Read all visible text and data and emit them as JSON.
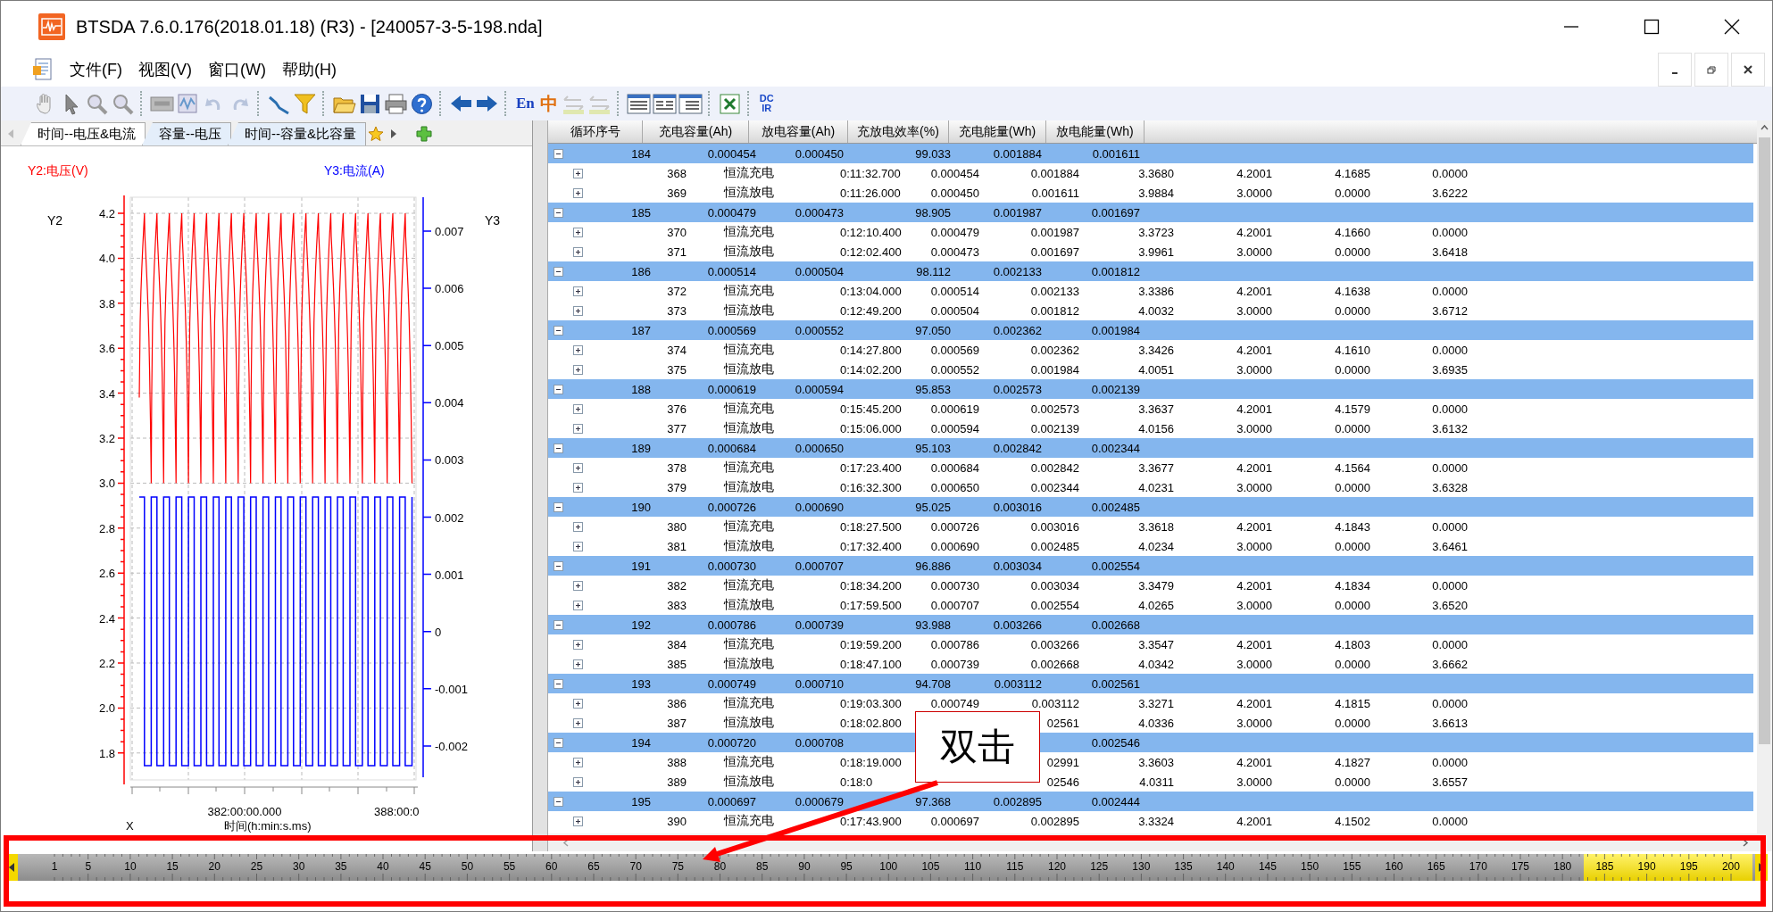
{
  "window": {
    "title": "BTSDA 7.6.0.176(2018.01.18) (R3) - [240057-3-5-198.nda]"
  },
  "menu": [
    {
      "label": "文件(F)"
    },
    {
      "label": "视图(V)"
    },
    {
      "label": "窗口(W)"
    },
    {
      "label": "帮助(H)"
    }
  ],
  "toolbar": {
    "language_label": "En",
    "chinese_label": "中",
    "dcir_top": "DC",
    "dcir_bottom": "IR"
  },
  "tabs": [
    {
      "label": "时间--电压&电流",
      "selected": true
    },
    {
      "label": "容量--电压",
      "selected": false
    },
    {
      "label": "时间--容量&比容量",
      "selected": false
    }
  ],
  "chart": {
    "y2_legend": "Y2:电压(V)",
    "y3_legend": "Y3:电流(A)",
    "y2_name": "Y2",
    "y3_name": "Y3",
    "y2_ticks": [
      "4.2",
      "4.0",
      "3.8",
      "3.6",
      "3.4",
      "3.2",
      "3.0",
      "2.8",
      "2.6",
      "2.4",
      "2.2",
      "2.0",
      "1.8"
    ],
    "y3_ticks": [
      "0.007",
      "0.006",
      "0.005",
      "0.004",
      "0.003",
      "0.002",
      "0.001",
      "0",
      "-0.001",
      "-0.002"
    ],
    "x_ticks": [
      "382:00:00.000",
      "388:00:0"
    ],
    "x_name": "X",
    "x_title": "时间(h:min:s.ms)"
  },
  "table": {
    "columns": [
      "循环序号",
      "充电容量(Ah)",
      "放电容量(Ah)",
      "充放电效率(%)",
      "充电能量(Wh)",
      "放电能量(Wh)"
    ],
    "groups": [
      {
        "expanded": true,
        "cells": [
          "184",
          "0.000454",
          "0.000450",
          "99.033",
          "0.001884",
          "0.001611"
        ],
        "children": [
          {
            "expanded": false,
            "cells": [
              "368",
              "恒流充电",
              "0:11:32.700",
              "0.000454",
              "0.001884",
              "3.3680",
              "4.2001",
              "4.1685",
              "0.0000"
            ]
          },
          {
            "expanded": false,
            "cells": [
              "369",
              "恒流放电",
              "0:11:26.000",
              "0.000450",
              "0.001611",
              "3.9884",
              "3.0000",
              "0.0000",
              "3.6222"
            ]
          }
        ]
      },
      {
        "expanded": true,
        "cells": [
          "185",
          "0.000479",
          "0.000473",
          "98.905",
          "0.001987",
          "0.001697"
        ],
        "children": [
          {
            "expanded": false,
            "cells": [
              "370",
              "恒流充电",
              "0:12:10.400",
              "0.000479",
              "0.001987",
              "3.3723",
              "4.2001",
              "4.1660",
              "0.0000"
            ]
          },
          {
            "expanded": false,
            "cells": [
              "371",
              "恒流放电",
              "0:12:02.400",
              "0.000473",
              "0.001697",
              "3.9961",
              "3.0000",
              "0.0000",
              "3.6418"
            ]
          }
        ]
      },
      {
        "expanded": true,
        "cells": [
          "186",
          "0.000514",
          "0.000504",
          "98.112",
          "0.002133",
          "0.001812"
        ],
        "children": [
          {
            "expanded": false,
            "cells": [
              "372",
              "恒流充电",
              "0:13:04.000",
              "0.000514",
              "0.002133",
              "3.3386",
              "4.2001",
              "4.1638",
              "0.0000"
            ]
          },
          {
            "expanded": false,
            "cells": [
              "373",
              "恒流放电",
              "0:12:49.200",
              "0.000504",
              "0.001812",
              "4.0032",
              "3.0000",
              "0.0000",
              "3.6712"
            ]
          }
        ]
      },
      {
        "expanded": true,
        "cells": [
          "187",
          "0.000569",
          "0.000552",
          "97.050",
          "0.002362",
          "0.001984"
        ],
        "children": [
          {
            "expanded": false,
            "cells": [
              "374",
              "恒流充电",
              "0:14:27.800",
              "0.000569",
              "0.002362",
              "3.3426",
              "4.2001",
              "4.1610",
              "0.0000"
            ]
          },
          {
            "expanded": false,
            "cells": [
              "375",
              "恒流放电",
              "0:14:02.200",
              "0.000552",
              "0.001984",
              "4.0051",
              "3.0000",
              "0.0000",
              "3.6935"
            ]
          }
        ]
      },
      {
        "expanded": true,
        "cells": [
          "188",
          "0.000619",
          "0.000594",
          "95.853",
          "0.002573",
          "0.002139"
        ],
        "children": [
          {
            "expanded": false,
            "cells": [
              "376",
              "恒流充电",
              "0:15:45.200",
              "0.000619",
              "0.002573",
              "3.3637",
              "4.2001",
              "4.1579",
              "0.0000"
            ]
          },
          {
            "expanded": false,
            "cells": [
              "377",
              "恒流放电",
              "0:15:06.000",
              "0.000594",
              "0.002139",
              "4.0156",
              "3.0000",
              "0.0000",
              "3.6132"
            ]
          }
        ]
      },
      {
        "expanded": true,
        "cells": [
          "189",
          "0.000684",
          "0.000650",
          "95.103",
          "0.002842",
          "0.002344"
        ],
        "children": [
          {
            "expanded": false,
            "cells": [
              "378",
              "恒流充电",
              "0:17:23.400",
              "0.000684",
              "0.002842",
              "3.3677",
              "4.2001",
              "4.1564",
              "0.0000"
            ]
          },
          {
            "expanded": false,
            "cells": [
              "379",
              "恒流放电",
              "0:16:32.300",
              "0.000650",
              "0.002344",
              "4.0231",
              "3.0000",
              "0.0000",
              "3.6328"
            ]
          }
        ]
      },
      {
        "expanded": true,
        "cells": [
          "190",
          "0.000726",
          "0.000690",
          "95.025",
          "0.003016",
          "0.002485"
        ],
        "children": [
          {
            "expanded": false,
            "cells": [
              "380",
              "恒流充电",
              "0:18:27.500",
              "0.000726",
              "0.003016",
              "3.3618",
              "4.2001",
              "4.1843",
              "0.0000"
            ]
          },
          {
            "expanded": false,
            "cells": [
              "381",
              "恒流放电",
              "0:17:32.400",
              "0.000690",
              "0.002485",
              "4.0234",
              "3.0000",
              "0.0000",
              "3.6461"
            ]
          }
        ]
      },
      {
        "expanded": true,
        "cells": [
          "191",
          "0.000730",
          "0.000707",
          "96.886",
          "0.003034",
          "0.002554"
        ],
        "children": [
          {
            "expanded": false,
            "cells": [
              "382",
              "恒流充电",
              "0:18:34.200",
              "0.000730",
              "0.003034",
              "3.3479",
              "4.2001",
              "4.1834",
              "0.0000"
            ]
          },
          {
            "expanded": false,
            "cells": [
              "383",
              "恒流放电",
              "0:17:59.500",
              "0.000707",
              "0.002554",
              "4.0265",
              "3.0000",
              "0.0000",
              "3.6520"
            ]
          }
        ]
      },
      {
        "expanded": true,
        "cells": [
          "192",
          "0.000786",
          "0.000739",
          "93.988",
          "0.003266",
          "0.002668"
        ],
        "children": [
          {
            "expanded": false,
            "cells": [
              "384",
              "恒流充电",
              "0:19:59.200",
              "0.000786",
              "0.003266",
              "3.3547",
              "4.2001",
              "4.1803",
              "0.0000"
            ]
          },
          {
            "expanded": false,
            "cells": [
              "385",
              "恒流放电",
              "0:18:47.100",
              "0.000739",
              "0.002668",
              "4.0342",
              "3.0000",
              "0.0000",
              "3.6662"
            ]
          }
        ]
      },
      {
        "expanded": true,
        "cells": [
          "193",
          "0.000749",
          "0.000710",
          "94.708",
          "0.003112",
          "0.002561"
        ],
        "children": [
          {
            "expanded": false,
            "cells": [
              "386",
              "恒流充电",
              "0:19:03.300",
              "0.000749",
              "0.003112",
              "3.3271",
              "4.2001",
              "4.1815",
              "0.0000"
            ]
          },
          {
            "expanded": false,
            "cells": [
              "387",
              "恒流放电",
              "0:18:02.800",
              null,
              "02561",
              "4.0336",
              "3.0000",
              "0.0000",
              "3.6613"
            ]
          }
        ]
      },
      {
        "expanded": true,
        "cells": [
          "194",
          "0.000720",
          "0.000708",
          null,
          null,
          "0.002546"
        ],
        "children": [
          {
            "expanded": false,
            "cells": [
              "388",
              "恒流充电",
              "0:18:19.000",
              null,
              "02991",
              "3.3603",
              "4.2001",
              "4.1827",
              "0.0000"
            ]
          },
          {
            "expanded": false,
            "cells": [
              "389",
              "恒流放电",
              "0:18:0",
              null,
              "02546",
              "4.0311",
              "3.0000",
              "0.0000",
              "3.6557"
            ]
          }
        ]
      },
      {
        "expanded": true,
        "cells": [
          "195",
          "0.000697",
          "0.000679",
          "97.368",
          "0.002895",
          "0.002444"
        ],
        "children": [
          {
            "expanded": false,
            "cells": [
              "390",
              "恒流充电",
              "0:17:43.900",
              "0.000697",
              "0.002895",
              "3.3324",
              "4.2001",
              "4.1502",
              "0.0000"
            ]
          }
        ]
      }
    ]
  },
  "ruler": {
    "labels": [
      {
        "text": "1",
        "selected": false
      },
      {
        "text": "5",
        "selected": false
      },
      {
        "text": "10",
        "selected": false
      },
      {
        "text": "15",
        "selected": false
      },
      {
        "text": "20",
        "selected": false
      },
      {
        "text": "25",
        "selected": false
      },
      {
        "text": "30",
        "selected": false
      },
      {
        "text": "35",
        "selected": false
      },
      {
        "text": "40",
        "selected": false
      },
      {
        "text": "45",
        "selected": false
      },
      {
        "text": "50",
        "selected": false
      },
      {
        "text": "55",
        "selected": false
      },
      {
        "text": "60",
        "selected": false
      },
      {
        "text": "65",
        "selected": false
      },
      {
        "text": "70",
        "selected": false
      },
      {
        "text": "75",
        "selected": false
      },
      {
        "text": "80",
        "selected": false
      },
      {
        "text": "85",
        "selected": false
      },
      {
        "text": "90",
        "selected": false
      },
      {
        "text": "95",
        "selected": false
      },
      {
        "text": "100",
        "selected": false
      },
      {
        "text": "105",
        "selected": false
      },
      {
        "text": "110",
        "selected": false
      },
      {
        "text": "115",
        "selected": false
      },
      {
        "text": "120",
        "selected": false
      },
      {
        "text": "125",
        "selected": false
      },
      {
        "text": "130",
        "selected": false
      },
      {
        "text": "135",
        "selected": false
      },
      {
        "text": "140",
        "selected": false
      },
      {
        "text": "145",
        "selected": false
      },
      {
        "text": "150",
        "selected": false
      },
      {
        "text": "155",
        "selected": false
      },
      {
        "text": "160",
        "selected": false
      },
      {
        "text": "165",
        "selected": false
      },
      {
        "text": "170",
        "selected": false
      },
      {
        "text": "175",
        "selected": false
      },
      {
        "text": "180",
        "selected": false
      },
      {
        "text": "185",
        "selected": true
      },
      {
        "text": "190",
        "selected": true
      },
      {
        "text": "195",
        "selected": true
      },
      {
        "text": "200",
        "selected": true
      }
    ]
  },
  "annotation": {
    "text": "双击"
  }
}
